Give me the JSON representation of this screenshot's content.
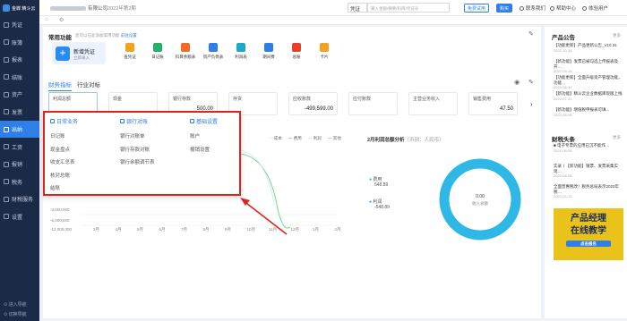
{
  "sidebar": {
    "logo": "金蝶 精斗云",
    "items": [
      {
        "label": "凭证"
      },
      {
        "label": "账簿"
      },
      {
        "label": "报表"
      },
      {
        "label": "结账"
      },
      {
        "label": "资产"
      },
      {
        "label": "发票"
      },
      {
        "label": "出纳"
      },
      {
        "label": "工资"
      },
      {
        "label": "报销"
      },
      {
        "label": "税务"
      },
      {
        "label": "财税服务"
      },
      {
        "label": "设置"
      }
    ],
    "active_index": 6,
    "footer": [
      "⊙ 进入导航",
      "⊙ 切换导航"
    ]
  },
  "topbar": {
    "company": "有限公司",
    "period": "2022年第2期",
    "search_type": "凭证",
    "search_placeholder": "输入金额/摘要/科目/凭证号",
    "free_trial": "免费试用",
    "buy": "购买",
    "contact": "联系我们",
    "help": "帮助中心",
    "user": "体验用户"
  },
  "quick": {
    "title": "常用功能",
    "subtitle": "您可以在此添加常用功能",
    "subtitle_link": "前往设置",
    "main_label": "新增凭证",
    "main_sub": "立即录入",
    "items": [
      {
        "label": "查凭证",
        "color": "#f0a31e"
      },
      {
        "label": "日记账",
        "color": "#23b06b"
      },
      {
        "label": "科目余额表",
        "color": "#f06a2a"
      },
      {
        "label": "资产负债表",
        "color": "#2f7fe9"
      },
      {
        "label": "利润表",
        "color": "#1ea8c8"
      },
      {
        "label": "期间费",
        "color": "#2f7fe9"
      },
      {
        "label": "总账",
        "color": "#e8402a"
      },
      {
        "label": "卡片",
        "color": "#f0a31e"
      }
    ]
  },
  "tabs": [
    "财务指标",
    "行业对标"
  ],
  "stats": [
    {
      "label": "利润总额",
      "value": ""
    },
    {
      "label": "现金",
      "value": ""
    },
    {
      "label": "银行存款",
      "value": "500.00"
    },
    {
      "label": "存货",
      "value": ""
    },
    {
      "label": "应收账款",
      "value": "-499,599.00"
    },
    {
      "label": "应付账款",
      "value": ""
    },
    {
      "label": "主营业务收入",
      "value": ""
    },
    {
      "label": "销售费用",
      "value": "47.50"
    }
  ],
  "popup": {
    "cols": [
      {
        "title": "日常业务",
        "items": [
          "日记账",
          "现金盘点",
          "收支汇总表",
          "核对总账",
          "结账"
        ]
      },
      {
        "title": "银行对账",
        "items": [
          "银行对账单",
          "银行存款对账",
          "银行余额调节表"
        ]
      },
      {
        "title": "基础设置",
        "items": [
          "账户",
          "报销设置"
        ]
      }
    ]
  },
  "chart": {
    "legend": [
      "成本",
      "费用",
      "利润",
      "其他"
    ],
    "y_ticks": [
      "-3,000,000",
      "-6,000,000",
      "-12,000,000"
    ],
    "x_ticks": [
      "3月",
      "4月",
      "5月",
      "6月",
      "7月",
      "8月",
      "9月",
      "10月",
      "11月",
      "12月",
      "1月",
      "2月"
    ],
    "donut_title": "2月利润总额分析",
    "donut_unit": "（币别：人民币）",
    "donut_legend": [
      {
        "label": "费用",
        "value": "548.89"
      },
      {
        "label": "利润",
        "value": "-548.89"
      }
    ],
    "donut_center_value": "0.00",
    "donut_center_label": "收入总额"
  },
  "right": {
    "notice_title": "产品公告",
    "more": "更多",
    "notices": [
      {
        "text": "【功能更新】产品更新公告_V10.31",
        "date": "2022-10-31"
      },
      {
        "text": "【新功能】发票已被勾选上传报表及开…",
        "date": "2022-09-15"
      },
      {
        "text": "【功能更新】全面升级资产管理功能，功能…",
        "date": "2022-08-31"
      },
      {
        "text": "【新功能】精斗云企业数据库现版上线",
        "date": "2022-07-31"
      },
      {
        "text": "【新功能】增值税申报表可填...",
        "date": "2022-06-08"
      }
    ],
    "news_title": "财税头条",
    "news": [
      {
        "text": "■ 电子专票的应用已沉不能作…",
        "date": "2021-06-08"
      },
      {
        "text": "实录丨【新功能】银票、发票采集实现…",
        "date": "2022-06-08"
      },
      {
        "text": "全面普惠税改！税务总局表示2022年税…",
        "date": "2022-04-15"
      }
    ],
    "ad_line1": "产品经理",
    "ad_line2": "在线教学",
    "ad_btn": "点击报名"
  }
}
